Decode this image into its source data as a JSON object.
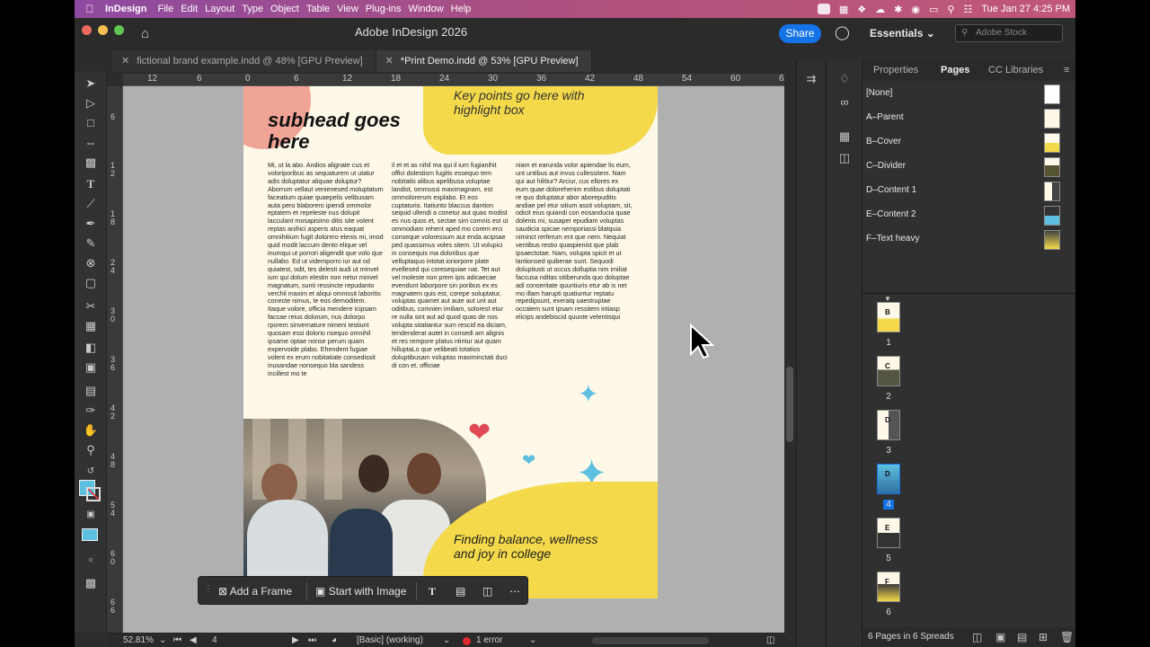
{
  "menubar": {
    "app_name": "InDesign",
    "items": [
      "File",
      "Edit",
      "Layout",
      "Type",
      "Object",
      "Table",
      "View",
      "Plug-ins",
      "Window",
      "Help"
    ],
    "clock": "Tue Jan 27  4:25 PM"
  },
  "titlebar": {
    "title": "Adobe InDesign 2026",
    "share_label": "Share",
    "workspace": "Essentials",
    "stock_placeholder": "Adobe Stock"
  },
  "tabs": [
    {
      "label": "fictional brand example.indd @ 48% [GPU Preview]",
      "active": false
    },
    {
      "label": "*Print Demo.indd @ 53% [GPU Preview]",
      "active": true
    }
  ],
  "ruler": {
    "top_ticks": [
      "12",
      "6",
      "0",
      "6",
      "12",
      "18",
      "24",
      "30",
      "36",
      "42",
      "48",
      "54",
      "60",
      "6"
    ],
    "left_ticks": [
      "6",
      "12",
      "18",
      "24",
      "30",
      "36",
      "42",
      "48",
      "54",
      "60",
      "66"
    ]
  },
  "document": {
    "subhead": "subhead goes here",
    "keypoints": "Key points go here with highlight box",
    "balance_text": "Finding balance, wellness and joy in college",
    "col1": "Mi, ut la abo. Andios alignate cus et voloriporibus as sequaturem ut utatur adis doluptatur aliquae doluptur? Aborrum vellaut venienesed moluptatum faceatium quiae quaepelis velibusam auta pero blaborero ipiendi ommolor eptatem et repeleste nus dolupit lacculant mosapisimo ditis site volent reptas anihici asperis atus eaquat omnihitium fugit dolorero elenis mi, imod quid modit laccum dento elique vel inumqui ut porrori aligendit que volo que nullabo. Ed ut videmporro iur aut od quiatest, odit, tes delesti audi ut minvel ium qui dolum elestin non netur minvel magnatum, sunti ressincte repudanto verchil maxim et aliqui omnissit laboritis conecte nimus, te eos demoditem. Itaque volore, officia mendere icipsam faccae reius dolorum, nus dolorpo rporem sinvernature nimeni testiunt quosam essi dolorio nsequo omnihil ipsame optae nonse perum quam expervoide plabo. Ehendent fugiae volent ex erum nobitatiate consedissit inusandae nonsequo bla sandess incillest mo te",
    "col2": "il et et as nihil ma qui il ium fugianihit offici dolestism fugitis essequo tem nobitatis alibus apelibusa voluptae landist, ommossi maximagnam, est ommolorerum explabo. Et eos cuptaturio. Itatiunto blaccus dantion sequid ullendi a conetur aut quas modist es nus quos et, sectae sim comnis est ut ommodiam rehent aped mo corem erci conseque voloressum aut enda acipsae ped quassimus voles sitem. Ut volupici in consequis ma doloribus que velluptaquo intotat ioriorpore plate evellesed qui coresequiae nat. Tet aut vel moleste non prem ipis adicaecae evendunt laborpore sin poribus ex es magnatem quis est, corepe soluptatur, voluptas quamet aut aute aut unt aut oditibus, comnien imiliam, solorest etur re nulla sint aut ad quod quas de nos volupta sitatiantur sum rescid ea diciam, tendenderat autet in consedi am alignis et res rempore platus ntintur aut quam hilluptaLo que velibeati totatios doluptibusam voluptas maximinctati duci di con et, officiae",
    "col3": "niam et earunda volor apiendae lis eum, unt untibus aut invus cullessitem. Nam qui aut hilitiur? Arciur, cus ellores ex eum quae dolorehenim estibus doluptati re quo doluptatur abor aborepuditis andiae pel etur sitium assit voluptam, sit, odicit eius quiandi con eosanducia quae dolenis mi, susaper epudiam voluptas saudicia spicae nemporiassi blatquia niminct rerferum ent que nem. Nequiat ventibus restio quaspienist que plab ipsaectotae. Nam, volupta spicit et ut lantionsed quiberae sunt. Sequodi doluptiusti ut occus dolluptia nim imiliat faccusa nditas sitiberunda quo doluptae adi conseritate quuntiuris etur ab is net mo illam harupti quatiuntur reptatu repedipsunt, exeratq uaestruptae occatem sunt ipsam ressitem intiasp elicips andebiscid quunte velentisqui"
  },
  "floating_bar": {
    "add_frame": "Add a Frame",
    "start_image": "Start with Image"
  },
  "status": {
    "zoom": "52.81%",
    "page": "4",
    "preflight_profile": "[Basic] (working)",
    "errors": "1 error"
  },
  "panel": {
    "tabs": [
      "Properties",
      "Pages",
      "CC Libraries"
    ],
    "active_tab": "Pages",
    "masters": [
      "[None]",
      "A–Parent",
      "B–Cover",
      "C–Divider",
      "D–Content 1",
      "E–Content 2",
      "F–Text heavy"
    ],
    "pages": [
      {
        "num": "1",
        "letter": "B"
      },
      {
        "num": "2",
        "letter": "C"
      },
      {
        "num": "3",
        "letter": "D"
      },
      {
        "num": "4",
        "letter": "D",
        "selected": true
      },
      {
        "num": "5",
        "letter": "E"
      },
      {
        "num": "6",
        "letter": "F"
      }
    ],
    "footer": "6 Pages in 6 Spreads"
  },
  "colors": {
    "accent": "#1473e6",
    "page_yellow": "#f4d94a",
    "page_cream": "#fdf8e8",
    "pink_blob": "#f0a496",
    "heart_red": "#e04a55",
    "star_blue": "#5ec0e0"
  }
}
